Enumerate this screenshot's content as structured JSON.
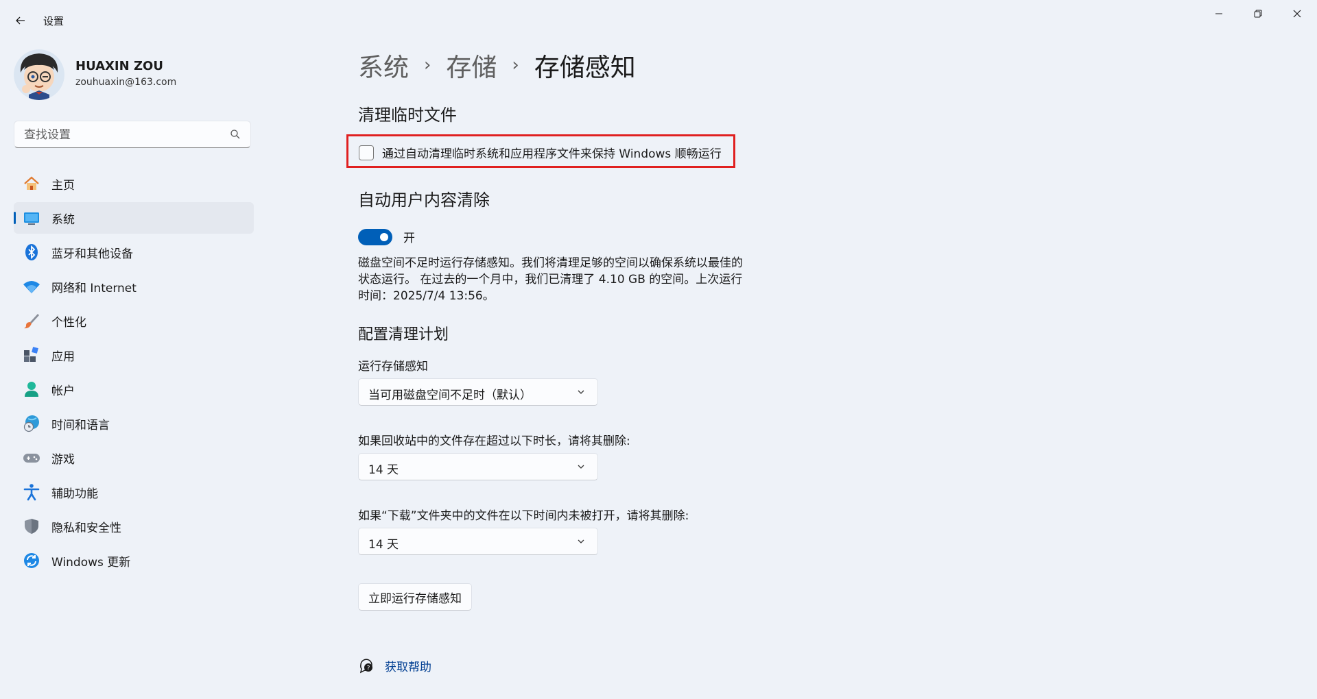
{
  "window": {
    "title": "设置"
  },
  "user": {
    "name": "HUAXIN ZOU",
    "email": "zouhuaxin@163.com"
  },
  "search": {
    "placeholder": "查找设置"
  },
  "sidebar": {
    "items": [
      {
        "label": "主页",
        "icon": "home-icon"
      },
      {
        "label": "系统",
        "icon": "system-icon",
        "active": true
      },
      {
        "label": "蓝牙和其他设备",
        "icon": "bluetooth-icon"
      },
      {
        "label": "网络和 Internet",
        "icon": "wifi-icon"
      },
      {
        "label": "个性化",
        "icon": "brush-icon"
      },
      {
        "label": "应用",
        "icon": "apps-icon"
      },
      {
        "label": "帐户",
        "icon": "account-icon"
      },
      {
        "label": "时间和语言",
        "icon": "globe-clock-icon"
      },
      {
        "label": "游戏",
        "icon": "gamepad-icon"
      },
      {
        "label": "辅助功能",
        "icon": "accessibility-icon"
      },
      {
        "label": "隐私和安全性",
        "icon": "shield-icon"
      },
      {
        "label": "Windows 更新",
        "icon": "update-icon"
      }
    ]
  },
  "breadcrumb": [
    "系统",
    "存储",
    "存储感知"
  ],
  "sections": {
    "temp_files": {
      "heading": "清理临时文件",
      "checkbox_label": "通过自动清理临时系统和应用程序文件来保持 Windows 顺畅运行",
      "checked": false
    },
    "auto_cleanup": {
      "heading": "自动用户内容清除",
      "toggle_label": "开",
      "toggle_on": true,
      "description": "磁盘空间不足时运行存储感知。我们将清理足够的空间以确保系统以最佳的状态运行。 在过去的一个月中，我们已清理了 4.10 GB 的空间。上次运行时间：2025/7/4 13:56。"
    },
    "schedule": {
      "heading": "配置清理计划",
      "run_label": "运行存储感知",
      "run_value": "当可用磁盘空间不足时（默认）",
      "recycle_label": "如果回收站中的文件存在超过以下时长，请将其删除:",
      "recycle_value": "14 天",
      "downloads_label": "如果“下载”文件夹中的文件在以下时间内未被打开，请将其删除:",
      "downloads_value": "14 天"
    },
    "run_now_label": "立即运行存储感知",
    "help_label": "获取帮助"
  },
  "colors": {
    "accent": "#005fb8",
    "background": "#eef2f8",
    "highlight": "#e02020"
  }
}
